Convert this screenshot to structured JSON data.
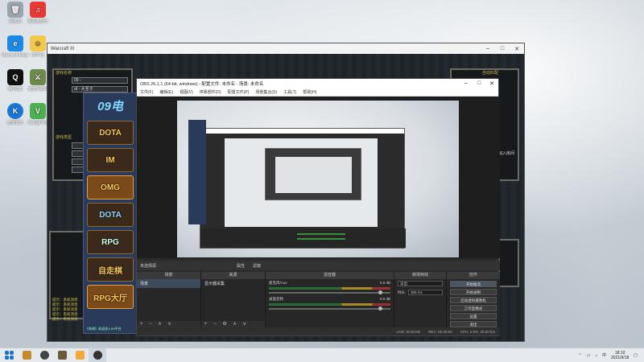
{
  "desktop": {
    "icons": [
      {
        "label": "回收站",
        "color": "#9aa4ad",
        "glyph": "🗑"
      },
      {
        "label": "网易云音乐",
        "color": "#e53935",
        "glyph": "♫"
      },
      {
        "label": "Microsoft Edge",
        "color": "#1e88e5",
        "glyph": "e"
      },
      {
        "label": "09平台",
        "color": "#f2c94c",
        "glyph": "☺"
      },
      {
        "label": "腾讯QQ",
        "color": "#111111",
        "glyph": "Q"
      },
      {
        "label": "魔兽争霸III",
        "color": "#6d8a4a",
        "glyph": "⚔"
      },
      {
        "label": "酷狗音乐",
        "color": "#1976d2",
        "glyph": "K"
      },
      {
        "label": "09对战平台",
        "color": "#4caf50",
        "glyph": "V"
      }
    ]
  },
  "war3": {
    "title": "Warcraft III",
    "labels": [
      "游戏名称",
      "游戏类型",
      "自动匹配"
    ],
    "fields": [
      "09 -",
      "dt - 大圣子"
    ],
    "right_label": "自动匹配",
    "chat": [
      "提示：系统消息",
      "提示：系统消息",
      "提示：系统消息",
      "提示：系统消息",
      "提示：系统消息"
    ],
    "join_text": "加入房间"
  },
  "platform09": {
    "logo": "09电",
    "games": [
      "DOTA",
      "IM",
      "OMG",
      "DOTA",
      "RPG",
      "自走棋",
      "RPG大厅"
    ],
    "footer": "《系统》欢迎进入09平台"
  },
  "obs": {
    "title": "OBS 26.1.1 (64-bit, windows) - 配置文件: 未命名 - 场景: 未命名",
    "menu": [
      "文件(F)",
      "编辑(E)",
      "视图(V)",
      "停靠部件(D)",
      "配置文件(P)",
      "场景集合(S)",
      "工具(T)",
      "帮助(H)"
    ],
    "status_left": "未选择源",
    "status_buttons": [
      "属性",
      "滤镜"
    ],
    "docks": {
      "scenes": {
        "header": "场景",
        "items": [
          "场景"
        ]
      },
      "sources": {
        "header": "来源",
        "items": [
          "显示器采集"
        ]
      },
      "mixer": {
        "header": "混音器",
        "channels": [
          {
            "name": "麦克风/Aux",
            "db": "0.0 dB"
          },
          {
            "name": "桌面音频",
            "db": "0.0 dB"
          }
        ]
      },
      "transitions": {
        "header": "转场特效",
        "type": "淡出",
        "duration_label": "时长",
        "duration": "300 ms"
      },
      "controls": {
        "header": "控件",
        "buttons": [
          "开始推流",
          "开始录制",
          "启动虚拟摄像机",
          "工作室模式",
          "设置",
          "退出"
        ]
      }
    },
    "footer": [
      "LIVE: 00:00:00",
      "REC: 00:00:00",
      "CPU: 2.5%, 30.00 fps"
    ]
  },
  "taskbar": {
    "time": "18:10",
    "date": "2021/9/18",
    "icons": [
      "start",
      "09",
      "obs",
      "war3",
      "app",
      "obs-running"
    ]
  }
}
